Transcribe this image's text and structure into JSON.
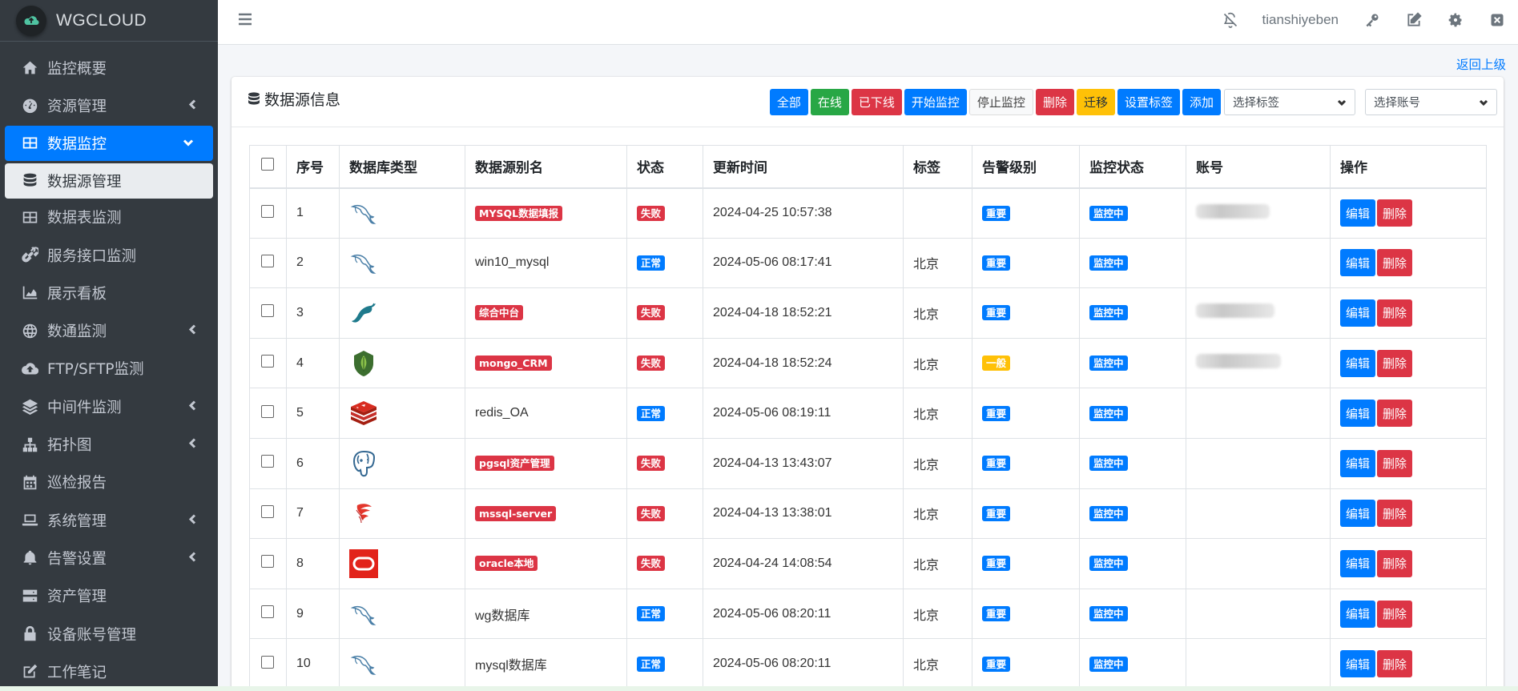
{
  "brand": {
    "name": "WGCLOUD"
  },
  "sidebar": {
    "items": [
      {
        "label": "监控概要",
        "icon": "home-icon"
      },
      {
        "label": "资源管理",
        "icon": "tachometer-icon",
        "arrow": true
      },
      {
        "label": "数据监控",
        "icon": "table-icon",
        "arrow": true,
        "active": true
      },
      {
        "label": "数据源管理",
        "icon": "database-icon",
        "sub": true
      },
      {
        "label": "数据表监测",
        "icon": "table-icon"
      },
      {
        "label": "服务接口监测",
        "icon": "link-icon"
      },
      {
        "label": "展示看板",
        "icon": "chart-area-icon"
      },
      {
        "label": "数通监测",
        "icon": "globe-icon",
        "arrow": true
      },
      {
        "label": "FTP/SFTP监测",
        "icon": "cloud-upload-icon"
      },
      {
        "label": "中间件监测",
        "icon": "layers-icon",
        "arrow": true
      },
      {
        "label": "拓扑图",
        "icon": "sitemap-icon",
        "arrow": true
      },
      {
        "label": "巡检报告",
        "icon": "calendar-icon"
      },
      {
        "label": "系统管理",
        "icon": "laptop-icon",
        "arrow": true
      },
      {
        "label": "告警设置",
        "icon": "bell-icon",
        "arrow": true
      },
      {
        "label": "资产管理",
        "icon": "server-icon"
      },
      {
        "label": "设备账号管理",
        "icon": "lock-icon"
      },
      {
        "label": "工作笔记",
        "icon": "edit-icon"
      }
    ]
  },
  "header": {
    "username": "tianshiyeben"
  },
  "back_link": "返回上级",
  "card": {
    "title": "数据源信息",
    "toolbar": {
      "all": "全部",
      "online": "在线",
      "offline": "已下线",
      "start": "开始监控",
      "stop": "停止监控",
      "delete": "删除",
      "migrate": "迁移",
      "set_tag": "设置标签",
      "add": "添加",
      "tag_select": "选择标签",
      "account_select": "选择账号"
    }
  },
  "table": {
    "headers": [
      "",
      "序号",
      "数据库类型",
      "数据源别名",
      "状态",
      "更新时间",
      "标签",
      "告警级别",
      "监控状态",
      "账号",
      "操作"
    ],
    "rows": [
      {
        "no": "1",
        "db": "mysql",
        "alias": "MYSQL数据填报",
        "alias_badge": true,
        "status": "失败",
        "time": "2024-04-25 10:57:38",
        "tag": "",
        "level": "重要",
        "monitor": "监控中",
        "account": "blur"
      },
      {
        "no": "2",
        "db": "mysql",
        "alias": "win10_mysql",
        "alias_badge": false,
        "status": "正常",
        "time": "2024-05-06 08:17:41",
        "tag": "北京",
        "level": "重要",
        "monitor": "监控中",
        "account": ""
      },
      {
        "no": "3",
        "db": "mariadb",
        "alias": "综合中台",
        "alias_badge": true,
        "status": "失败",
        "time": "2024-04-18 18:52:21",
        "tag": "北京",
        "level": "重要",
        "monitor": "监控中",
        "account": "blur"
      },
      {
        "no": "4",
        "db": "mongodb",
        "alias": "mongo_CRM",
        "alias_badge": true,
        "status": "失败",
        "time": "2024-04-18 18:52:24",
        "tag": "北京",
        "level": "一般",
        "monitor": "监控中",
        "account": "blur"
      },
      {
        "no": "5",
        "db": "redis",
        "alias": "redis_OA",
        "alias_badge": false,
        "status": "正常",
        "time": "2024-05-06 08:19:11",
        "tag": "北京",
        "level": "重要",
        "monitor": "监控中",
        "account": ""
      },
      {
        "no": "6",
        "db": "postgresql",
        "alias": "pgsql资产管理",
        "alias_badge": true,
        "status": "失败",
        "time": "2024-04-13 13:43:07",
        "tag": "北京",
        "level": "重要",
        "monitor": "监控中",
        "account": ""
      },
      {
        "no": "7",
        "db": "sqlserver",
        "alias": "mssql-server",
        "alias_badge": true,
        "status": "失败",
        "time": "2024-04-13 13:38:01",
        "tag": "北京",
        "level": "重要",
        "monitor": "监控中",
        "account": ""
      },
      {
        "no": "8",
        "db": "oracle",
        "alias": "oracle本地",
        "alias_badge": true,
        "status": "失败",
        "time": "2024-04-24 14:08:54",
        "tag": "北京",
        "level": "重要",
        "monitor": "监控中",
        "account": ""
      },
      {
        "no": "9",
        "db": "mysql",
        "alias": "wg数据库",
        "alias_badge": false,
        "status": "正常",
        "time": "2024-05-06 08:20:11",
        "tag": "北京",
        "level": "重要",
        "monitor": "监控中",
        "account": ""
      },
      {
        "no": "10",
        "db": "mysql",
        "alias": "mysql数据库",
        "alias_badge": false,
        "status": "正常",
        "time": "2024-05-06 08:20:11",
        "tag": "北京",
        "level": "重要",
        "monitor": "监控中",
        "account": ""
      }
    ],
    "edit_label": "编辑",
    "delete_label": "删除"
  },
  "colors": {
    "primary": "#007bff",
    "danger": "#dc3545",
    "success": "#28a745",
    "warning": "#ffc107",
    "sidebar": "#343a40"
  }
}
